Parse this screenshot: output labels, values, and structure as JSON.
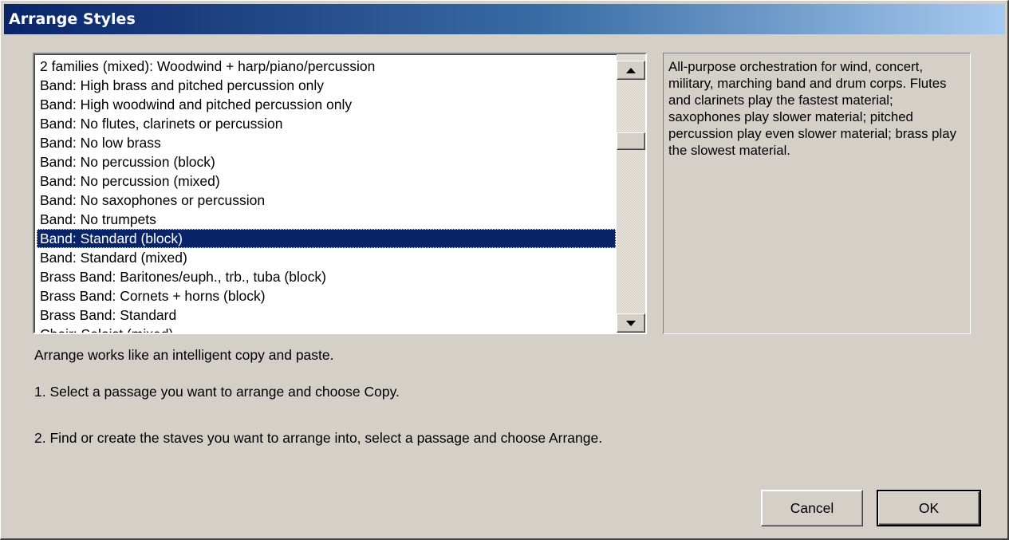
{
  "window": {
    "title": "Arrange Styles"
  },
  "styles_list": {
    "items": [
      "2 families (mixed): Woodwind + harp/piano/percussion",
      "Band: High brass and pitched percussion only",
      "Band: High woodwind and pitched percussion only",
      "Band: No flutes, clarinets or percussion",
      "Band: No low brass",
      "Band: No percussion (block)",
      "Band: No percussion (mixed)",
      "Band: No saxophones or percussion",
      "Band: No trumpets",
      "Band: Standard (block)",
      "Band: Standard (mixed)",
      "Brass Band: Baritones/euph., trb., tuba (block)",
      "Brass Band: Cornets + horns (block)",
      "Brass Band: Standard",
      "Choir: Soloist (mixed)"
    ],
    "selected": "Band: Standard (block)"
  },
  "description": "All-purpose orchestration for wind, concert, military, marching band and drum corps. Flutes and clarinets play the fastest material; saxophones play slower material; pitched percussion play even slower material; brass play the slowest material.",
  "info": {
    "line1": "Arrange works like an intelligent copy and paste.",
    "line2": "1. Select a passage you want to arrange and choose Copy.",
    "line3": "2. Find or create the staves you want to arrange into, select a passage and choose Arrange."
  },
  "buttons": {
    "cancel": "Cancel",
    "ok": "OK"
  },
  "icons": {
    "scroll_up": "arrow-up-icon",
    "scroll_down": "arrow-down-icon"
  },
  "colors": {
    "title_start": "#0a246a",
    "title_end": "#a6caf0",
    "selection": "#0a246a",
    "face": "#d4d0c8"
  }
}
